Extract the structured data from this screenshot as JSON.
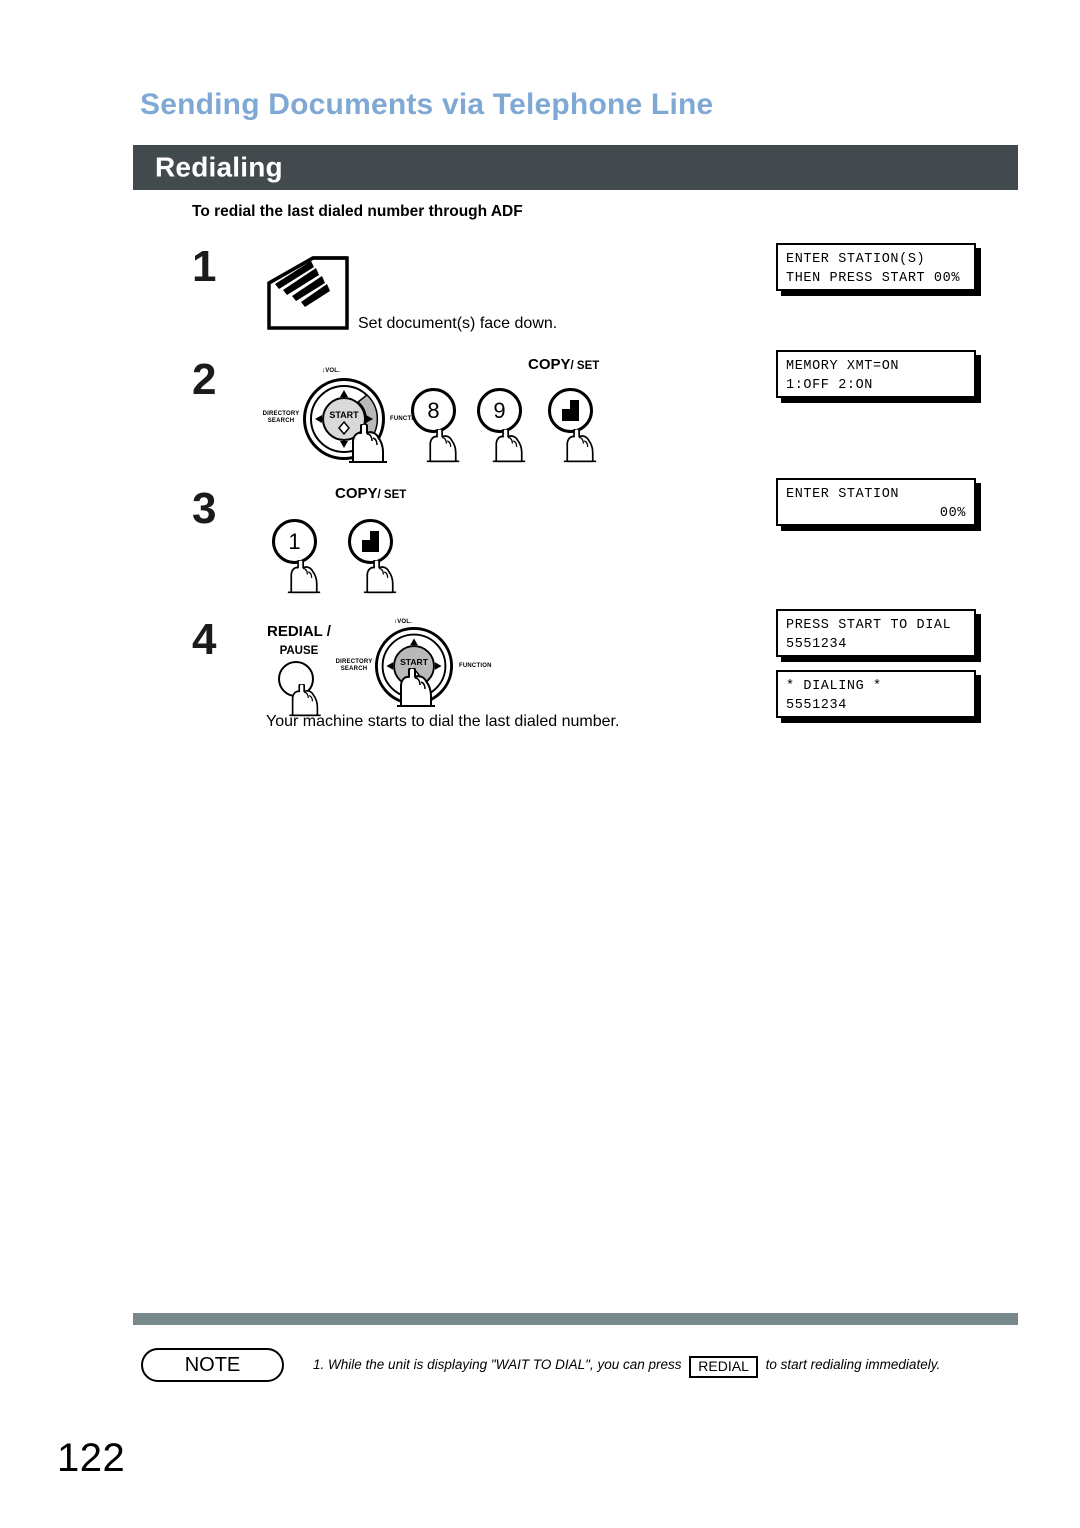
{
  "header": {
    "chapter_title": "Sending Documents via Telephone Line",
    "section_title": "Redialing",
    "subhead": "To redial the last dialed number through ADF"
  },
  "steps": [
    {
      "number": "1",
      "caption": "Set document(s) face down.",
      "icon": "adf-document-stack-icon"
    },
    {
      "number": "2",
      "caption": "",
      "keys": [
        "8",
        "9"
      ],
      "set_label_big": "COPY",
      "set_label_small": "/ SET",
      "dial": {
        "center": "START",
        "top": "VOL.",
        "left": "DIRECTORY\nSEARCH",
        "right": "FUNCTION",
        "highlight": "right-arrow"
      }
    },
    {
      "number": "3",
      "caption": "",
      "keys": [
        "1"
      ],
      "set_label_big": "COPY",
      "set_label_small": "/ SET"
    },
    {
      "number": "4",
      "caption": "Your machine starts to dial the last dialed number.",
      "redial_label_big": "REDIAL /",
      "redial_label_small": "PAUSE",
      "dial": {
        "center": "START",
        "top": "VOL.",
        "left": "DIRECTORY\nSEARCH",
        "right": "FUNCTION",
        "highlight": "center-start"
      }
    }
  ],
  "displays": [
    {
      "line1": "ENTER STATION(S)",
      "line2": "THEN PRESS START 00%",
      "align2": "left"
    },
    {
      "line1": "MEMORY XMT=ON",
      "line2": "1:OFF 2:ON",
      "align2": "left"
    },
    {
      "line1": "ENTER STATION",
      "line2": "00%",
      "align2": "right"
    },
    {
      "line1": "PRESS START TO DIAL",
      "line2": "5551234",
      "align2": "left"
    },
    {
      "line1": "* DIALING *",
      "line2": "5551234",
      "align2": "left"
    }
  ],
  "footer": {
    "note_label": "NOTE",
    "note_number": "1.",
    "note_text_before": "While the unit is displaying \"WAIT TO DIAL\", you can press",
    "note_chip": "REDIAL",
    "note_text_after": "to start redialing immediately.",
    "page_number": "122"
  },
  "colors": {
    "chapter_title": "#7fa9d4",
    "section_bar": "#434a4e",
    "footer_rule": "#77898a"
  }
}
